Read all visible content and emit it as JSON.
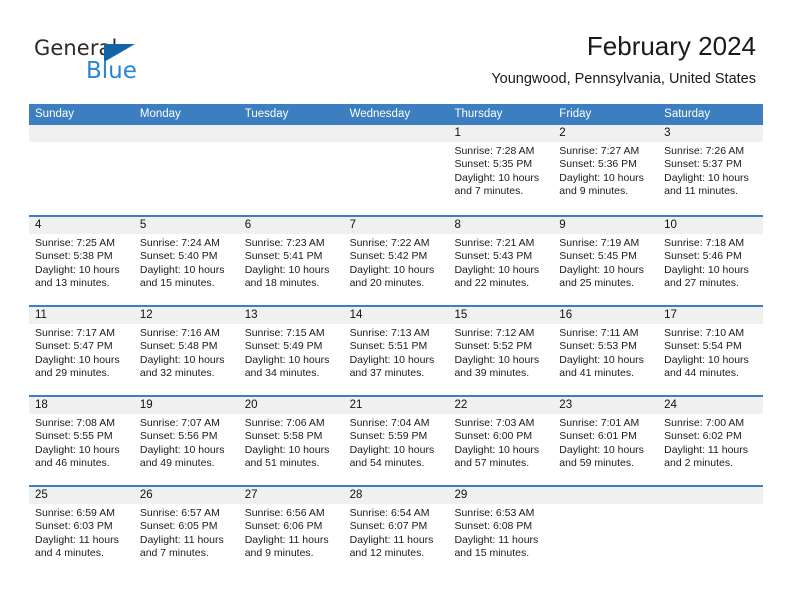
{
  "brand": {
    "name_part1": "General",
    "name_part2": "Blue",
    "flag_color": "#1464a5",
    "blue_color": "#2787d6"
  },
  "header": {
    "title": "February 2024",
    "subtitle": "Youngwood, Pennsylvania, United States"
  },
  "theme": {
    "header_blue": "#3c7ebf",
    "day_band_gray": "#f0f0f0"
  },
  "calendar": {
    "weekdays": [
      "Sunday",
      "Monday",
      "Tuesday",
      "Wednesday",
      "Thursday",
      "Friday",
      "Saturday"
    ],
    "labels": {
      "sunrise": "Sunrise:",
      "sunset": "Sunset:",
      "daylight": "Daylight:"
    },
    "weeks": [
      [
        {
          "date": "",
          "empty": true
        },
        {
          "date": "",
          "empty": true
        },
        {
          "date": "",
          "empty": true
        },
        {
          "date": "",
          "empty": true
        },
        {
          "date": "1",
          "sunrise": "Sunrise: 7:28 AM",
          "sunset": "Sunset: 5:35 PM",
          "daylight_line1": "Daylight: 10 hours",
          "daylight_line2": "and 7 minutes."
        },
        {
          "date": "2",
          "sunrise": "Sunrise: 7:27 AM",
          "sunset": "Sunset: 5:36 PM",
          "daylight_line1": "Daylight: 10 hours",
          "daylight_line2": "and 9 minutes."
        },
        {
          "date": "3",
          "sunrise": "Sunrise: 7:26 AM",
          "sunset": "Sunset: 5:37 PM",
          "daylight_line1": "Daylight: 10 hours",
          "daylight_line2": "and 11 minutes."
        }
      ],
      [
        {
          "date": "4",
          "sunrise": "Sunrise: 7:25 AM",
          "sunset": "Sunset: 5:38 PM",
          "daylight_line1": "Daylight: 10 hours",
          "daylight_line2": "and 13 minutes."
        },
        {
          "date": "5",
          "sunrise": "Sunrise: 7:24 AM",
          "sunset": "Sunset: 5:40 PM",
          "daylight_line1": "Daylight: 10 hours",
          "daylight_line2": "and 15 minutes."
        },
        {
          "date": "6",
          "sunrise": "Sunrise: 7:23 AM",
          "sunset": "Sunset: 5:41 PM",
          "daylight_line1": "Daylight: 10 hours",
          "daylight_line2": "and 18 minutes."
        },
        {
          "date": "7",
          "sunrise": "Sunrise: 7:22 AM",
          "sunset": "Sunset: 5:42 PM",
          "daylight_line1": "Daylight: 10 hours",
          "daylight_line2": "and 20 minutes."
        },
        {
          "date": "8",
          "sunrise": "Sunrise: 7:21 AM",
          "sunset": "Sunset: 5:43 PM",
          "daylight_line1": "Daylight: 10 hours",
          "daylight_line2": "and 22 minutes."
        },
        {
          "date": "9",
          "sunrise": "Sunrise: 7:19 AM",
          "sunset": "Sunset: 5:45 PM",
          "daylight_line1": "Daylight: 10 hours",
          "daylight_line2": "and 25 minutes."
        },
        {
          "date": "10",
          "sunrise": "Sunrise: 7:18 AM",
          "sunset": "Sunset: 5:46 PM",
          "daylight_line1": "Daylight: 10 hours",
          "daylight_line2": "and 27 minutes."
        }
      ],
      [
        {
          "date": "11",
          "sunrise": "Sunrise: 7:17 AM",
          "sunset": "Sunset: 5:47 PM",
          "daylight_line1": "Daylight: 10 hours",
          "daylight_line2": "and 29 minutes."
        },
        {
          "date": "12",
          "sunrise": "Sunrise: 7:16 AM",
          "sunset": "Sunset: 5:48 PM",
          "daylight_line1": "Daylight: 10 hours",
          "daylight_line2": "and 32 minutes."
        },
        {
          "date": "13",
          "sunrise": "Sunrise: 7:15 AM",
          "sunset": "Sunset: 5:49 PM",
          "daylight_line1": "Daylight: 10 hours",
          "daylight_line2": "and 34 minutes."
        },
        {
          "date": "14",
          "sunrise": "Sunrise: 7:13 AM",
          "sunset": "Sunset: 5:51 PM",
          "daylight_line1": "Daylight: 10 hours",
          "daylight_line2": "and 37 minutes."
        },
        {
          "date": "15",
          "sunrise": "Sunrise: 7:12 AM",
          "sunset": "Sunset: 5:52 PM",
          "daylight_line1": "Daylight: 10 hours",
          "daylight_line2": "and 39 minutes."
        },
        {
          "date": "16",
          "sunrise": "Sunrise: 7:11 AM",
          "sunset": "Sunset: 5:53 PM",
          "daylight_line1": "Daylight: 10 hours",
          "daylight_line2": "and 41 minutes."
        },
        {
          "date": "17",
          "sunrise": "Sunrise: 7:10 AM",
          "sunset": "Sunset: 5:54 PM",
          "daylight_line1": "Daylight: 10 hours",
          "daylight_line2": "and 44 minutes."
        }
      ],
      [
        {
          "date": "18",
          "sunrise": "Sunrise: 7:08 AM",
          "sunset": "Sunset: 5:55 PM",
          "daylight_line1": "Daylight: 10 hours",
          "daylight_line2": "and 46 minutes."
        },
        {
          "date": "19",
          "sunrise": "Sunrise: 7:07 AM",
          "sunset": "Sunset: 5:56 PM",
          "daylight_line1": "Daylight: 10 hours",
          "daylight_line2": "and 49 minutes."
        },
        {
          "date": "20",
          "sunrise": "Sunrise: 7:06 AM",
          "sunset": "Sunset: 5:58 PM",
          "daylight_line1": "Daylight: 10 hours",
          "daylight_line2": "and 51 minutes."
        },
        {
          "date": "21",
          "sunrise": "Sunrise: 7:04 AM",
          "sunset": "Sunset: 5:59 PM",
          "daylight_line1": "Daylight: 10 hours",
          "daylight_line2": "and 54 minutes."
        },
        {
          "date": "22",
          "sunrise": "Sunrise: 7:03 AM",
          "sunset": "Sunset: 6:00 PM",
          "daylight_line1": "Daylight: 10 hours",
          "daylight_line2": "and 57 minutes."
        },
        {
          "date": "23",
          "sunrise": "Sunrise: 7:01 AM",
          "sunset": "Sunset: 6:01 PM",
          "daylight_line1": "Daylight: 10 hours",
          "daylight_line2": "and 59 minutes."
        },
        {
          "date": "24",
          "sunrise": "Sunrise: 7:00 AM",
          "sunset": "Sunset: 6:02 PM",
          "daylight_line1": "Daylight: 11 hours",
          "daylight_line2": "and 2 minutes."
        }
      ],
      [
        {
          "date": "25",
          "sunrise": "Sunrise: 6:59 AM",
          "sunset": "Sunset: 6:03 PM",
          "daylight_line1": "Daylight: 11 hours",
          "daylight_line2": "and 4 minutes."
        },
        {
          "date": "26",
          "sunrise": "Sunrise: 6:57 AM",
          "sunset": "Sunset: 6:05 PM",
          "daylight_line1": "Daylight: 11 hours",
          "daylight_line2": "and 7 minutes."
        },
        {
          "date": "27",
          "sunrise": "Sunrise: 6:56 AM",
          "sunset": "Sunset: 6:06 PM",
          "daylight_line1": "Daylight: 11 hours",
          "daylight_line2": "and 9 minutes."
        },
        {
          "date": "28",
          "sunrise": "Sunrise: 6:54 AM",
          "sunset": "Sunset: 6:07 PM",
          "daylight_line1": "Daylight: 11 hours",
          "daylight_line2": "and 12 minutes."
        },
        {
          "date": "29",
          "sunrise": "Sunrise: 6:53 AM",
          "sunset": "Sunset: 6:08 PM",
          "daylight_line1": "Daylight: 11 hours",
          "daylight_line2": "and 15 minutes."
        },
        {
          "date": "",
          "empty": true
        },
        {
          "date": "",
          "empty": true
        }
      ]
    ]
  }
}
